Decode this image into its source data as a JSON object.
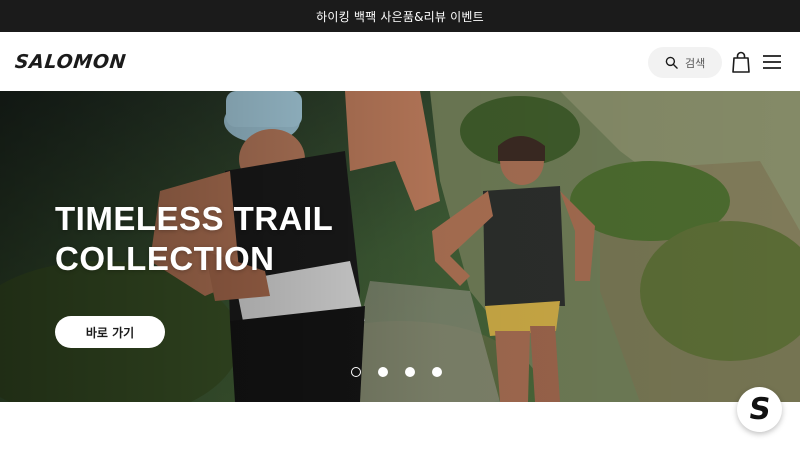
{
  "promo": {
    "text": "하이킹 백팩 사은품&리뷰 이벤트"
  },
  "header": {
    "logo_text": "SALOMON",
    "search_label": "검색",
    "icons": {
      "search": "search-icon",
      "bag": "shopping-bag-icon",
      "menu": "hamburger-menu-icon"
    }
  },
  "hero": {
    "title": "TIMELESS TRAIL\nCOLLECTION",
    "cta_label": "바로 가기",
    "slides": {
      "count": 4,
      "active_index": 0
    }
  },
  "chat": {
    "icon": "salomon-s-logo-icon"
  },
  "colors": {
    "promo_bg": "#1b1b1b",
    "text": "#1b1b1b",
    "search_bg": "#f2f2f2",
    "white": "#ffffff"
  }
}
